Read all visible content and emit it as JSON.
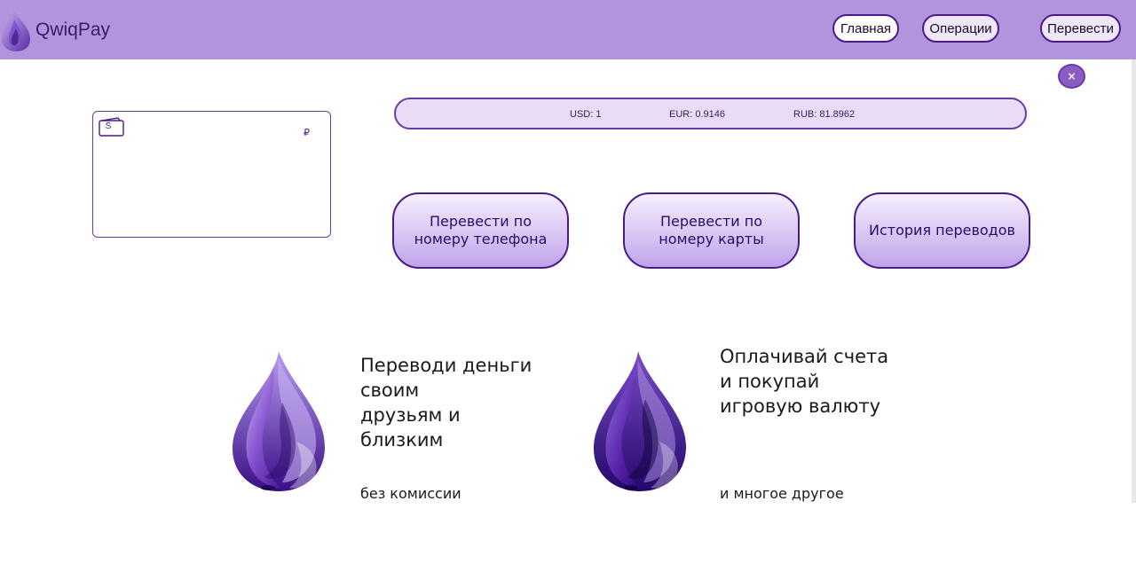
{
  "header": {
    "app_name": "QwiqPay",
    "nav": {
      "home": "Главная",
      "operations": "Операции",
      "transfer": "Перевести"
    }
  },
  "close_label": "×",
  "card": {
    "wallet_symbol": "S",
    "currency_symbol": "₽"
  },
  "rates": {
    "usd": "USD: 1",
    "eur": "EUR: 0.9146",
    "rub": "RUB: 81.8962"
  },
  "actions": {
    "phone": "Перевести по номеру телефона",
    "card": "Перевести по номеру карты",
    "history": "История переводов"
  },
  "promo": [
    {
      "title": "Переводи деньги\nсвоим\nдрузьям и\nблизким",
      "subtitle": "без комиссии"
    },
    {
      "title": "Оплачивай счета\nи покупай\nигровую валюту",
      "subtitle": "и многое другое"
    }
  ],
  "colors": {
    "header_bg": "#b095dd",
    "accent": "#4a1a8c",
    "rates_bg": "#e9dcf7"
  }
}
